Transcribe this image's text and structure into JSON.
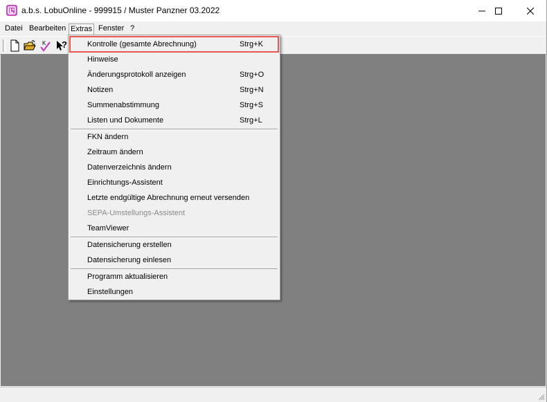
{
  "window": {
    "title": "a.b.s. LobuOnline -  999915 / Muster Panzner 03.2022",
    "controls": {
      "minimize_icon": "minimize-icon",
      "maximize_icon": "maximize-icon",
      "close_icon": "close-icon"
    }
  },
  "menubar": {
    "items": [
      {
        "label": "Datei"
      },
      {
        "label": "Bearbeiten"
      },
      {
        "label": "Extras"
      },
      {
        "label": "Fenster"
      },
      {
        "label": "?"
      }
    ]
  },
  "toolbar": {
    "buttons": [
      "new-document-icon",
      "open-folder-icon",
      "check-k-icon",
      "help-pointer-icon"
    ]
  },
  "extras_menu": {
    "items": [
      {
        "label": "Kontrolle (gesamte Abrechnung)",
        "shortcut": "Strg+K"
      },
      {
        "label": "Hinweise",
        "shortcut": ""
      },
      {
        "label": "Änderungsprotokoll anzeigen",
        "shortcut": "Strg+O"
      },
      {
        "label": "Notizen",
        "shortcut": "Strg+N"
      },
      {
        "label": "Summenabstimmung",
        "shortcut": "Strg+S"
      },
      {
        "label": "Listen und Dokumente",
        "shortcut": "Strg+L"
      },
      {
        "label": "FKN ändern",
        "shortcut": ""
      },
      {
        "label": "Zeitraum ändern",
        "shortcut": ""
      },
      {
        "label": "Datenverzeichnis ändern",
        "shortcut": ""
      },
      {
        "label": "Einrichtungs-Assistent",
        "shortcut": ""
      },
      {
        "label": "Letzte endgültige Abrechnung erneut versenden",
        "shortcut": ""
      },
      {
        "label": "SEPA-Umstellungs-Assistent",
        "shortcut": ""
      },
      {
        "label": "TeamViewer",
        "shortcut": ""
      },
      {
        "label": "Datensicherung erstellen",
        "shortcut": ""
      },
      {
        "label": "Datensicherung einlesen",
        "shortcut": ""
      },
      {
        "label": "Programm aktualisieren",
        "shortcut": ""
      },
      {
        "label": "Einstellungen",
        "shortcut": ""
      }
    ]
  },
  "colors": {
    "highlight_border": "#e8574e",
    "client_background": "#808080",
    "app_icon": "#c94fc3"
  }
}
